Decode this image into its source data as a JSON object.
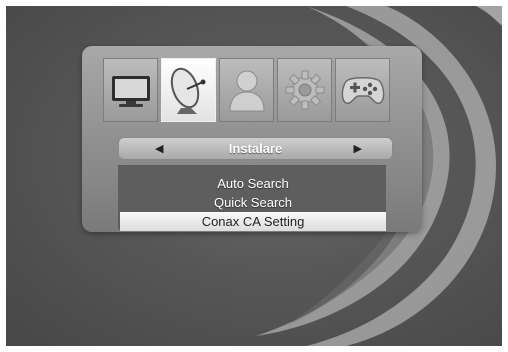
{
  "main_menu": {
    "tiles": [
      {
        "name": "tv-icon",
        "selected": false
      },
      {
        "name": "satellite-dish-icon",
        "selected": true
      },
      {
        "name": "user-icon",
        "selected": false
      },
      {
        "name": "gear-icon",
        "selected": false
      },
      {
        "name": "gamepad-icon",
        "selected": false
      }
    ]
  },
  "category": {
    "label": "Instalare",
    "prev_icon": "left-arrow-icon",
    "next_icon": "right-arrow-icon"
  },
  "submenu": {
    "items": [
      "Auto Search",
      "Quick Search",
      "Conax CA Setting"
    ],
    "highlighted_index": 2
  },
  "colors": {
    "background": "#555555",
    "panel": "#9a9a9a",
    "highlight": "#eeeeee"
  }
}
